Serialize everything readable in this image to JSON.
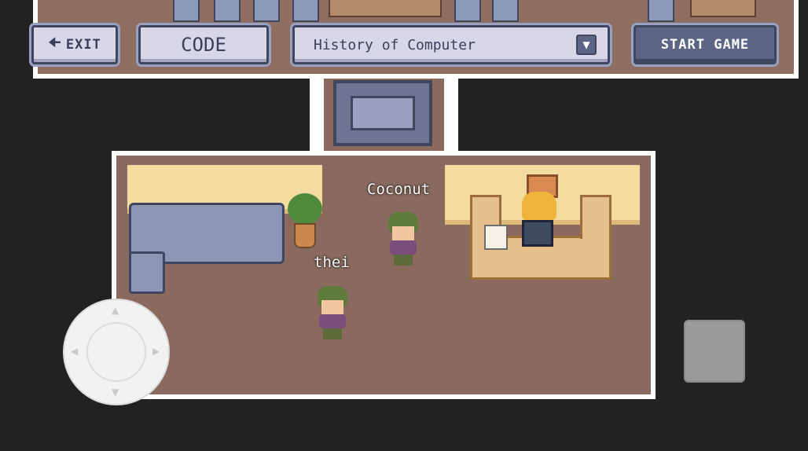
{
  "toolbar": {
    "exit_label": "EXIT",
    "exit_icon": "arrow-left-icon",
    "code_label": "CODE",
    "topic_select": {
      "selected": "History of Computer",
      "icon": "dropdown-arrow-icon"
    },
    "start_label": "START GAME"
  },
  "players": [
    {
      "name": "Coconut"
    },
    {
      "name": "thei"
    }
  ],
  "controls": {
    "joystick_icon": "dpad-joystick-icon",
    "action_button_icon": "action-button"
  },
  "colors": {
    "floor": "#8a6a5e",
    "wall": "#ffffff",
    "background": "#222222",
    "button_light": "#d7d7e8",
    "button_dark": "#5d6584",
    "accent_border": "#40465e"
  }
}
